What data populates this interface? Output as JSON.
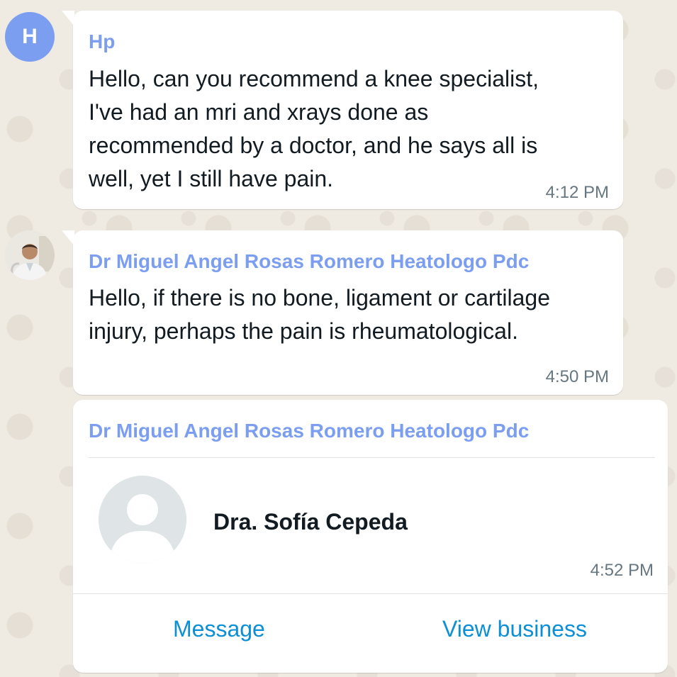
{
  "messages": [
    {
      "avatar_letter": "H",
      "sender": "Hp",
      "text": "Hello, can you recommend a knee specialist,\nI've had an mri and xrays done as\nrecommended by a doctor, and he says all is\nwell, yet I still have pain.",
      "time": "4:12 PM"
    },
    {
      "sender": "Dr Miguel Angel Rosas Romero Heatologo Pdc",
      "text": "Hello, if there is no bone, ligament or cartilage\ninjury, perhaps the pain is rheumatological.",
      "time": "4:50 PM"
    }
  ],
  "contact_card": {
    "sender": "Dr Miguel Angel Rosas Romero Heatologo Pdc",
    "contact_name": "Dra. Sofía Cepeda",
    "time": "4:52 PM",
    "message_action": "Message",
    "view_business_action": "View business"
  },
  "colors": {
    "sender_name": "#7b9ef0",
    "link": "#0b8fd6",
    "background": "#efeae2"
  },
  "icons": [
    "default-avatar-icon",
    "profile-photo"
  ]
}
